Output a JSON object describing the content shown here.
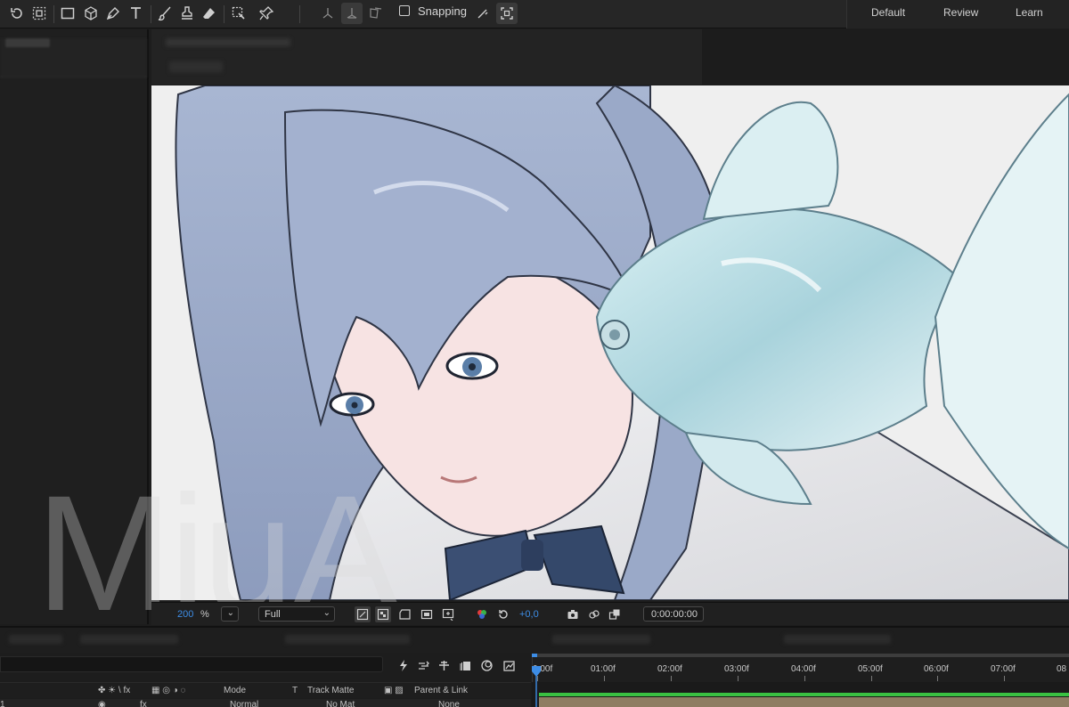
{
  "toolbar": {
    "snapping_label": "Snapping",
    "tools": [
      "rotate-tool-icon",
      "region-tool-icon",
      "rectangle-tool-icon",
      "3d-cube-tool-icon",
      "pen-tool-icon",
      "type-tool-icon",
      "brush-tool-icon",
      "clone-stamp-tool-icon",
      "eraser-tool-icon",
      "roto-brush-tool-icon",
      "puppet-pin-tool-icon"
    ],
    "axis_modes": [
      "local-axis-icon",
      "world-axis-icon",
      "view-axis-icon"
    ]
  },
  "workspaces": [
    "Default",
    "Review",
    "Learn"
  ],
  "viewer_footer": {
    "zoom_value": "200",
    "zoom_unit": "%",
    "resolution": "Full",
    "exposure": "+0,0",
    "timecode": "0:00:00:00"
  },
  "watermark": "MiuA",
  "timeline": {
    "columns": {
      "mode": "Mode",
      "t": "T",
      "track_matte": "Track Matte",
      "parent_link": "Parent & Link",
      "switch_glyphs": "✤ ☀ \\ fx"
    },
    "layer": {
      "index": "1",
      "fx": "fx",
      "mode": "Normal",
      "track_matte": "No Mat",
      "parent": "None"
    },
    "ruler_ticks": [
      "0:00f",
      "01:00f",
      "02:00f",
      "03:00f",
      "04:00f",
      "05:00f",
      "06:00f",
      "07:00f",
      "08"
    ],
    "colors": {
      "accent_blue": "#3d8de6",
      "track_green": "#39c142",
      "layer_bar": "#8e7d62"
    }
  }
}
